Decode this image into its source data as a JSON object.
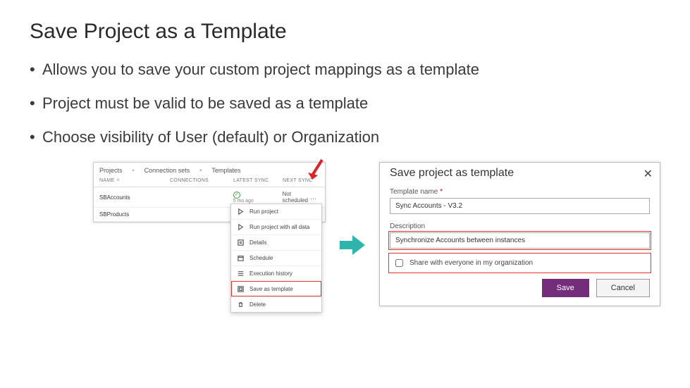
{
  "title": "Save Project as a Template",
  "bullets": [
    "Allows you to save your custom project mappings as a template",
    "Project must be valid to be saved as a template",
    "Choose visibility of User (default) or Organization"
  ],
  "leftPanel": {
    "tabs": {
      "projects": "Projects",
      "connSets": "Connection sets",
      "templates": "Templates"
    },
    "headers": {
      "name": "NAME",
      "connections": "CONNECTIONS",
      "latestSync": "LATEST SYNC",
      "nextSync": "NEXT SYNC"
    },
    "rows": [
      {
        "name": "SBAccounts",
        "syncAgo": "5 mo ago",
        "next": "Not scheduled",
        "more": "…"
      },
      {
        "name": "SBProducts"
      }
    ],
    "menu": {
      "run": "Run project",
      "runAll": "Run project with all data",
      "details": "Details",
      "schedule": "Schedule",
      "history": "Execution history",
      "saveTemplate": "Save as template",
      "delete": "Delete"
    }
  },
  "dialog": {
    "title": "Save project as template",
    "nameLabel": "Template name",
    "nameValue": "Sync Accounts - V3.2",
    "descLabel": "Description",
    "descValue": "Synchronize Accounts between instances",
    "shareLabel": "Share with everyone in my organization",
    "save": "Save",
    "cancel": "Cancel"
  }
}
